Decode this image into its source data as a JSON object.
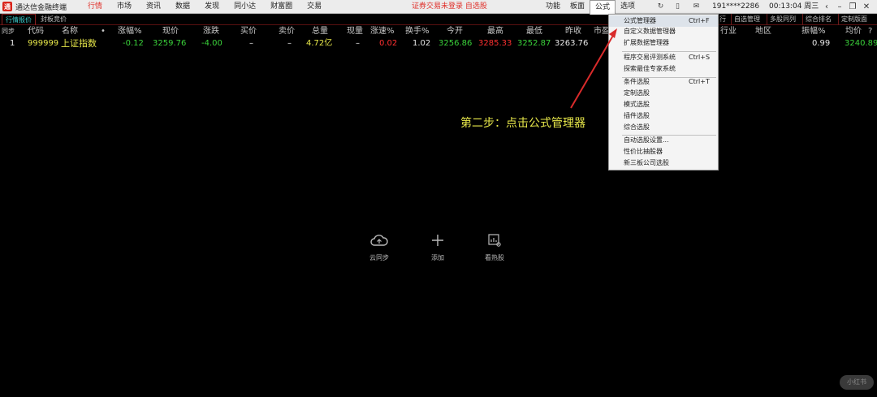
{
  "titlebar": {
    "app_title": "通达信金融终端",
    "menu": [
      "行情",
      "市场",
      "资讯",
      "数据",
      "发现",
      "同小达",
      "财富圈",
      "交易"
    ],
    "notice": "证券交易未登录  自选股",
    "right_menu": [
      "功能",
      "板面",
      "公式",
      "选项"
    ],
    "user": "191****2286",
    "clock": "00:13:04 周三"
  },
  "tabs": {
    "left": [
      "行情报价",
      "封板竞价"
    ],
    "right": [
      "行",
      "自选管理",
      "多股同列",
      "综合排名",
      "定制版面"
    ]
  },
  "table": {
    "headers": [
      "同步",
      "代码",
      "名称",
      "•",
      "涨幅%",
      "现价",
      "涨跌",
      "买价",
      "卖价",
      "总量",
      "现量",
      "涨速%",
      "换手%",
      "今开",
      "最高",
      "最低",
      "昨收",
      "市盈",
      "行业",
      "地区",
      "振幅%",
      "均价",
      "?"
    ],
    "rows": [
      {
        "index": "1",
        "code": "999999",
        "name": "上证指数",
        "pct": "-0.12",
        "price": "3259.76",
        "change": "-4.00",
        "bid": "–",
        "ask": "–",
        "volume": "4.72亿",
        "cur_vol": "–",
        "speed": "0.02",
        "turnover": "1.02",
        "open": "3256.86",
        "high": "3285.33",
        "low": "3252.87",
        "prev_close": "3263.76",
        "amplitude": "0.99",
        "avg": "3240.89"
      }
    ]
  },
  "dropdown": {
    "items": [
      {
        "label": "公式管理器",
        "shortcut": "Ctrl+F"
      },
      {
        "label": "自定义数据管理器",
        "shortcut": ""
      },
      {
        "label": "扩展数据管理器",
        "shortcut": ""
      },
      {
        "label": "程序交易评测系统",
        "shortcut": "Ctrl+S"
      },
      {
        "label": "探索最佳专家系统",
        "shortcut": ""
      },
      {
        "label": "条件选股",
        "shortcut": "Ctrl+T"
      },
      {
        "label": "定制选股",
        "shortcut": ""
      },
      {
        "label": "模式选股",
        "shortcut": ""
      },
      {
        "label": "插件选股",
        "shortcut": ""
      },
      {
        "label": "综合选股",
        "shortcut": ""
      },
      {
        "label": "自动选股设置...",
        "shortcut": ""
      },
      {
        "label": "性价比抽股器",
        "shortcut": ""
      },
      {
        "label": "新三板公司选股",
        "shortcut": ""
      }
    ]
  },
  "annotation": "第二步：点击公式管理器",
  "center_buttons": [
    "云同步",
    "添加",
    "看热股"
  ],
  "watermark": "小红书"
}
